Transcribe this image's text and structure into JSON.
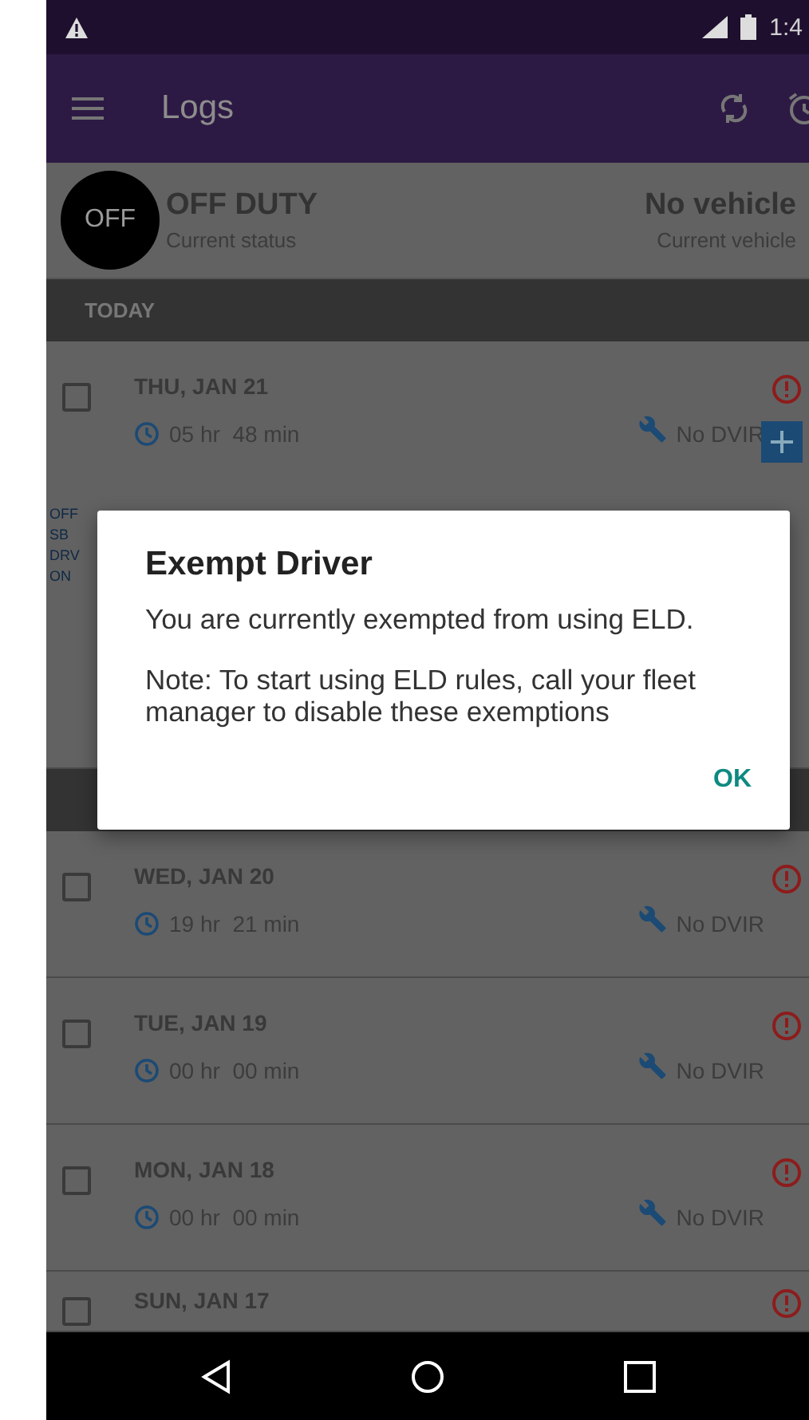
{
  "status_bar": {
    "time": "1:4"
  },
  "app_bar": {
    "title": "Logs"
  },
  "current": {
    "badge": "OFF",
    "status": "OFF DUTY",
    "status_label": "Current status",
    "vehicle": "No vehicle",
    "vehicle_label": "Current vehicle"
  },
  "sections": [
    {
      "title": "TODAY",
      "logs": [
        {
          "date": "THU, JAN 21",
          "duration": "05 hr  48 min",
          "dvir": "No DVIR",
          "checked": false,
          "chart_rows": [
            "OFF",
            "SB",
            "DRV",
            "ON"
          ]
        }
      ]
    },
    {
      "logs": [
        {
          "date": "WED, JAN 20",
          "duration": "19 hr  21 min",
          "dvir": "No DVIR",
          "checked": false
        },
        {
          "date": "TUE, JAN 19",
          "duration": "00 hr  00 min",
          "dvir": "No DVIR",
          "checked": false
        },
        {
          "date": "MON, JAN 18",
          "duration": "00 hr  00 min",
          "dvir": "No DVIR",
          "checked": false
        },
        {
          "date": "SUN, JAN 17",
          "checked": false
        }
      ]
    }
  ],
  "dialog": {
    "title": "Exempt Driver",
    "message": "You are currently exempted from using ELD.",
    "note": "Note: To start using ELD rules, call your fleet manager to disable these exemptions",
    "button": "OK"
  }
}
